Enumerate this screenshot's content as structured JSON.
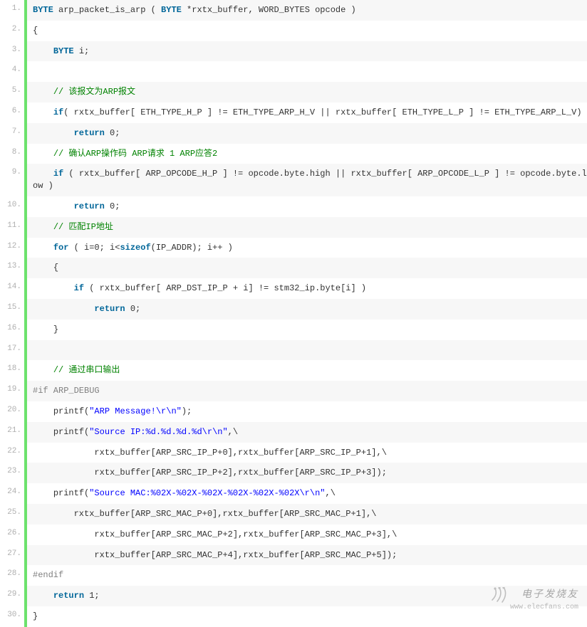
{
  "lines": [
    {
      "n": "1.",
      "tokens": [
        [
          "kw",
          "BYTE"
        ],
        [
          "pl",
          " arp_packet_is_arp ( "
        ],
        [
          "kw",
          "BYTE"
        ],
        [
          "pl",
          " *rxtx_buffer, WORD_BYTES opcode )"
        ]
      ]
    },
    {
      "n": "2.",
      "tokens": [
        [
          "pl",
          "{"
        ]
      ]
    },
    {
      "n": "3.",
      "tokens": [
        [
          "pl",
          "    "
        ],
        [
          "kw",
          "BYTE"
        ],
        [
          "pl",
          " i;"
        ]
      ]
    },
    {
      "n": "4.",
      "tokens": [
        [
          "pl",
          " "
        ]
      ]
    },
    {
      "n": "5.",
      "tokens": [
        [
          "pl",
          "    "
        ],
        [
          "cm",
          "// 该报文为ARP报文"
        ]
      ]
    },
    {
      "n": "6.",
      "tokens": [
        [
          "pl",
          "    "
        ],
        [
          "kw",
          "if"
        ],
        [
          "pl",
          "( rxtx_buffer[ ETH_TYPE_H_P ] != ETH_TYPE_ARP_H_V || rxtx_buffer[ ETH_TYPE_L_P ] != ETH_TYPE_ARP_L_V)"
        ]
      ]
    },
    {
      "n": "7.",
      "tokens": [
        [
          "pl",
          "        "
        ],
        [
          "kw",
          "return"
        ],
        [
          "pl",
          " 0;"
        ]
      ]
    },
    {
      "n": "8.",
      "tokens": [
        [
          "pl",
          "    "
        ],
        [
          "cm",
          "// 确认ARP操作码 ARP请求 1 ARP应答2"
        ]
      ]
    },
    {
      "n": "9.",
      "tokens": [
        [
          "pl",
          "    "
        ],
        [
          "kw",
          "if"
        ],
        [
          "pl",
          " ( rxtx_buffer[ ARP_OPCODE_H_P ] != opcode.byte.high || rxtx_buffer[ ARP_OPCODE_L_P ] != opcode.byte.low )"
        ]
      ]
    },
    {
      "n": "10.",
      "tokens": [
        [
          "pl",
          "        "
        ],
        [
          "kw",
          "return"
        ],
        [
          "pl",
          " 0;"
        ]
      ]
    },
    {
      "n": "11.",
      "tokens": [
        [
          "pl",
          "    "
        ],
        [
          "cm",
          "// 匹配IP地址"
        ]
      ]
    },
    {
      "n": "12.",
      "tokens": [
        [
          "pl",
          "    "
        ],
        [
          "kw",
          "for"
        ],
        [
          "pl",
          " ( i=0; i<"
        ],
        [
          "kw",
          "sizeof"
        ],
        [
          "pl",
          "(IP_ADDR); i++ )"
        ]
      ]
    },
    {
      "n": "13.",
      "tokens": [
        [
          "pl",
          "    {"
        ]
      ]
    },
    {
      "n": "14.",
      "tokens": [
        [
          "pl",
          "        "
        ],
        [
          "kw",
          "if"
        ],
        [
          "pl",
          " ( rxtx_buffer[ ARP_DST_IP_P + i] != stm32_ip.byte[i] )"
        ]
      ]
    },
    {
      "n": "15.",
      "tokens": [
        [
          "pl",
          "            "
        ],
        [
          "kw",
          "return"
        ],
        [
          "pl",
          " 0;"
        ]
      ]
    },
    {
      "n": "16.",
      "tokens": [
        [
          "pl",
          "    }"
        ]
      ]
    },
    {
      "n": "17.",
      "tokens": [
        [
          "pl",
          " "
        ]
      ]
    },
    {
      "n": "18.",
      "tokens": [
        [
          "pl",
          "    "
        ],
        [
          "cm",
          "// 通过串口输出"
        ]
      ]
    },
    {
      "n": "19.",
      "tokens": [
        [
          "pp",
          "#if ARP_DEBUG"
        ]
      ]
    },
    {
      "n": "20.",
      "tokens": [
        [
          "pl",
          "    "
        ],
        [
          "fn",
          "printf"
        ],
        [
          "pl",
          "("
        ],
        [
          "st",
          "\"ARP Message!\\r\\n\""
        ],
        [
          "pl",
          ");"
        ]
      ]
    },
    {
      "n": "21.",
      "tokens": [
        [
          "pl",
          "    "
        ],
        [
          "fn",
          "printf"
        ],
        [
          "pl",
          "("
        ],
        [
          "st",
          "\"Source IP:%d.%d.%d.%d\\r\\n\""
        ],
        [
          "pl",
          ",\\"
        ]
      ]
    },
    {
      "n": "22.",
      "tokens": [
        [
          "pl",
          "            rxtx_buffer[ARP_SRC_IP_P+0],rxtx_buffer[ARP_SRC_IP_P+1],\\"
        ]
      ]
    },
    {
      "n": "23.",
      "tokens": [
        [
          "pl",
          "            rxtx_buffer[ARP_SRC_IP_P+2],rxtx_buffer[ARP_SRC_IP_P+3]);"
        ]
      ]
    },
    {
      "n": "24.",
      "tokens": [
        [
          "pl",
          "    "
        ],
        [
          "fn",
          "printf"
        ],
        [
          "pl",
          "("
        ],
        [
          "st",
          "\"Source MAC:%02X-%02X-%02X-%02X-%02X-%02X\\r\\n\""
        ],
        [
          "pl",
          ",\\"
        ]
      ]
    },
    {
      "n": "25.",
      "tokens": [
        [
          "pl",
          "        rxtx_buffer[ARP_SRC_MAC_P+0],rxtx_buffer[ARP_SRC_MAC_P+1],\\"
        ]
      ]
    },
    {
      "n": "26.",
      "tokens": [
        [
          "pl",
          "            rxtx_buffer[ARP_SRC_MAC_P+2],rxtx_buffer[ARP_SRC_MAC_P+3],\\"
        ]
      ]
    },
    {
      "n": "27.",
      "tokens": [
        [
          "pl",
          "            rxtx_buffer[ARP_SRC_MAC_P+4],rxtx_buffer[ARP_SRC_MAC_P+5]);"
        ]
      ]
    },
    {
      "n": "28.",
      "tokens": [
        [
          "pp",
          "#endif"
        ]
      ]
    },
    {
      "n": "29.",
      "tokens": [
        [
          "pl",
          "    "
        ],
        [
          "kw",
          "return"
        ],
        [
          "pl",
          " 1;"
        ]
      ]
    },
    {
      "n": "30.",
      "tokens": [
        [
          "pl",
          "}"
        ]
      ]
    }
  ],
  "watermark": {
    "cn": "电子发烧友",
    "en": "www.elecfans.com"
  }
}
